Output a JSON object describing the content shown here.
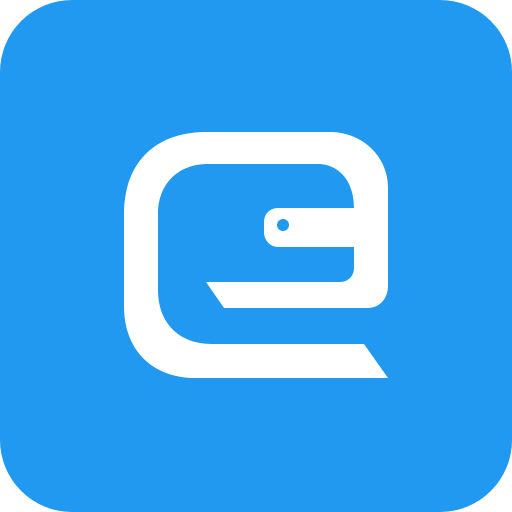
{
  "app_icon": {
    "name": "e-wallet-app-icon",
    "colors": {
      "tile": "#2199F0",
      "glyph": "#FFFFFF"
    },
    "glyph": "stylized-letter-e-wallet-icon"
  }
}
